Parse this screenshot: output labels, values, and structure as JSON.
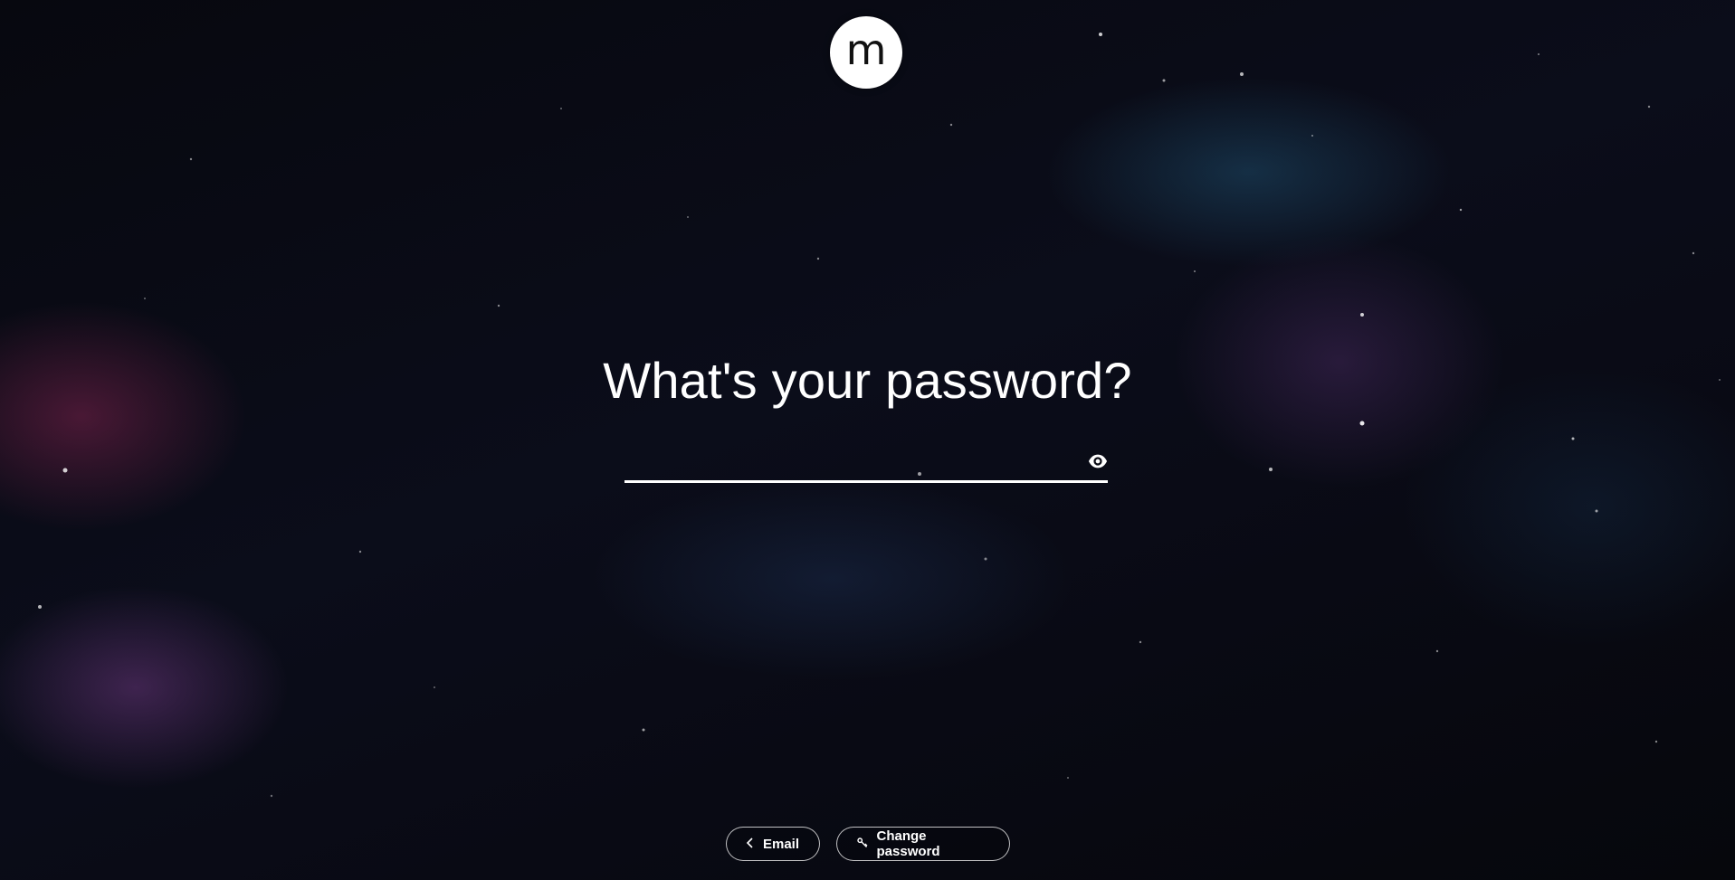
{
  "logo": {
    "letter": "m"
  },
  "prompt": {
    "title": "What's your password?"
  },
  "password_field": {
    "value": "",
    "placeholder": ""
  },
  "icons": {
    "reveal": "eye-icon",
    "back": "chevron-left-icon",
    "change": "key-icon"
  },
  "buttons": {
    "back_label": "Email",
    "change_password_label": "Change password"
  },
  "colors": {
    "text": "#ffffff",
    "logo_bg": "#ffffff",
    "background": "#05060b"
  }
}
